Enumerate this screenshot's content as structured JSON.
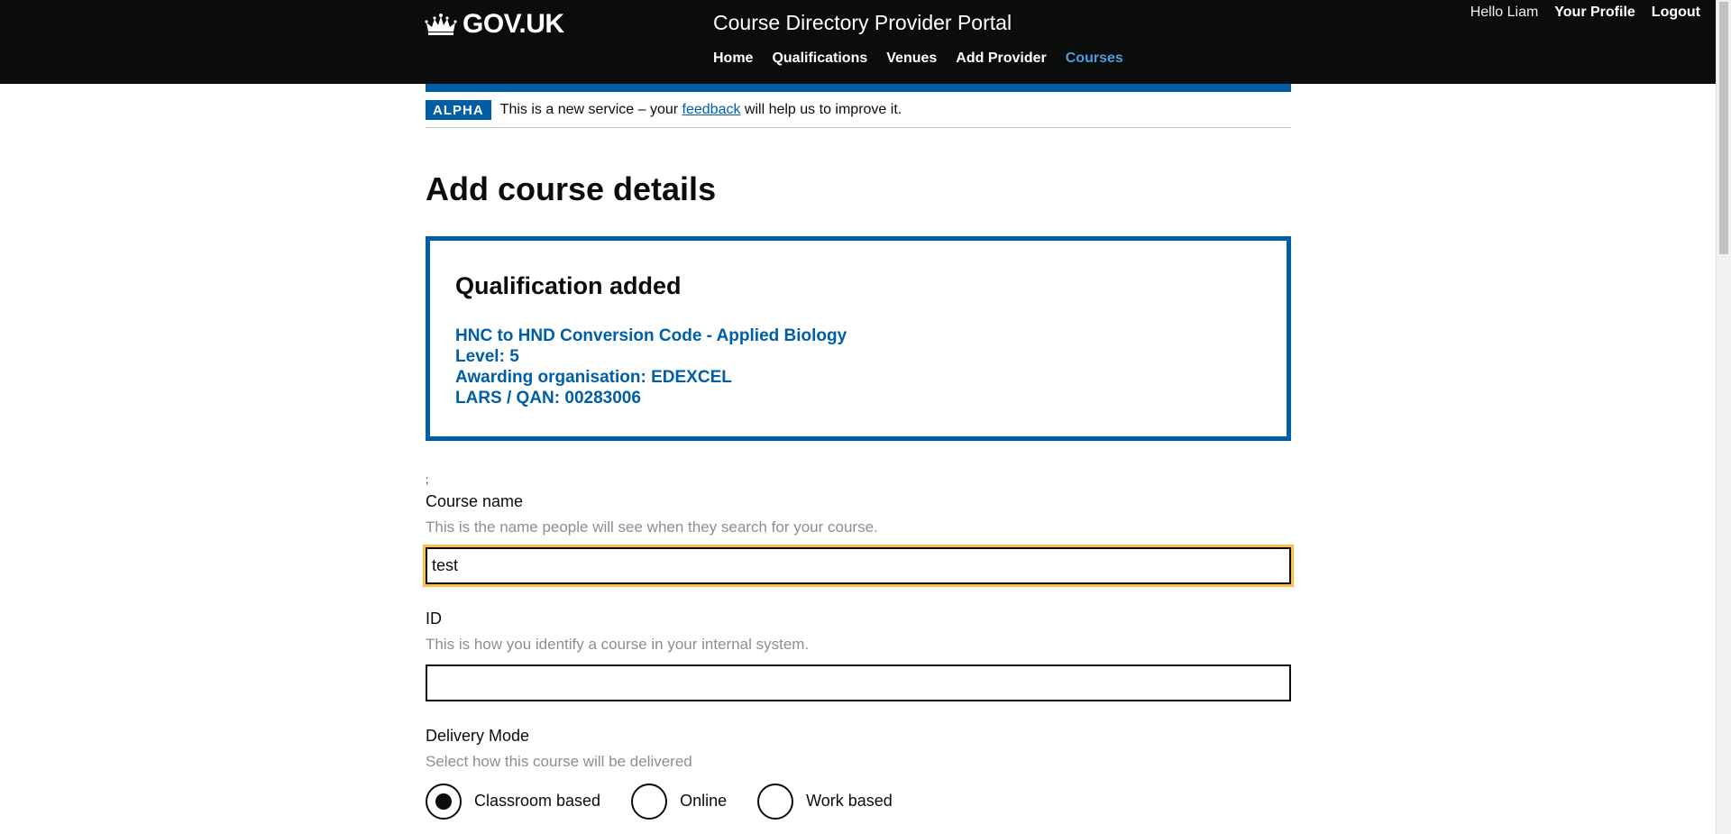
{
  "header": {
    "logo_text": "GOV.UK",
    "service_name": "Course Directory Provider Portal",
    "nav": [
      {
        "label": "Home",
        "active": false
      },
      {
        "label": "Qualifications",
        "active": false
      },
      {
        "label": "Venues",
        "active": false
      },
      {
        "label": "Add Provider",
        "active": false
      },
      {
        "label": "Courses",
        "active": true
      }
    ],
    "greeting": "Hello Liam",
    "profile_link": "Your Profile",
    "logout_link": "Logout"
  },
  "phase_banner": {
    "tag": "ALPHA",
    "text_before": "This is a new service – your ",
    "link": "feedback",
    "text_after": " will help us to improve it."
  },
  "page_title": "Add course details",
  "panel": {
    "heading": "Qualification added",
    "lines": [
      "HNC to HND Conversion Code - Applied Biology",
      "Level: 5",
      "Awarding organisation: EDEXCEL",
      "LARS / QAN: 00283006"
    ]
  },
  "stray_text": ";",
  "course_name": {
    "label": "Course name",
    "hint": "This is the name people will see when they search for your course.",
    "value": "test"
  },
  "course_id": {
    "label": "ID",
    "hint": "This is how you identify a course in your internal system.",
    "value": ""
  },
  "delivery_mode": {
    "label": "Delivery Mode",
    "hint": "Select how this course will be delivered",
    "options": [
      {
        "label": "Classroom based",
        "checked": true
      },
      {
        "label": "Online",
        "checked": false
      },
      {
        "label": "Work based",
        "checked": false
      }
    ]
  },
  "colors": {
    "header_bg": "#0b0c0c",
    "brand_blue": "#005ea5",
    "active_nav": "#4c9de0",
    "focus": "#ffbf47"
  }
}
